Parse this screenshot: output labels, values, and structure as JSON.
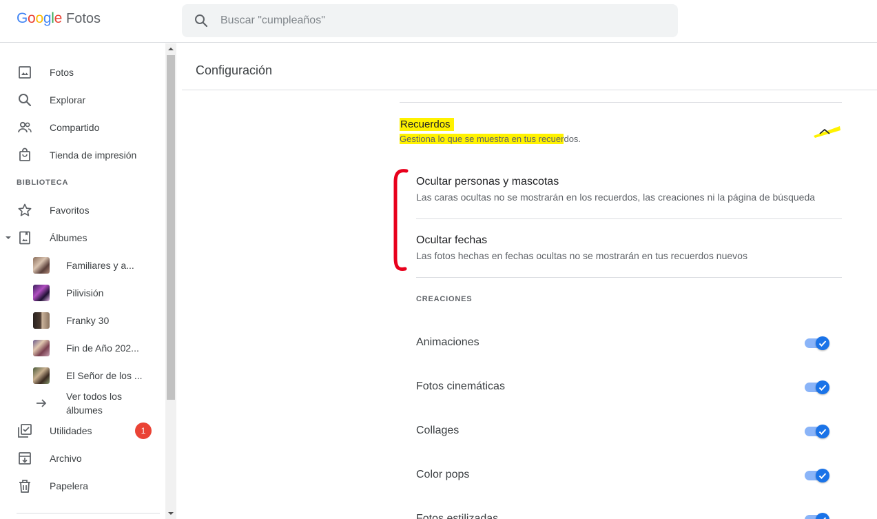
{
  "app": {
    "logo_google": "Google",
    "logo_product": "Fotos",
    "colors": {
      "blue": "#4285f4",
      "red": "#ea4335",
      "yellow": "#fbbc05",
      "green": "#34a853",
      "accent": "#1a73e8",
      "highlight": "#fff200",
      "annotation": "#e8001c"
    }
  },
  "search": {
    "placeholder": "Buscar \"cumpleaños\"",
    "value": "",
    "icon": "search-icon"
  },
  "sidebar": {
    "items": [
      {
        "label": "Fotos",
        "icon": "photo-icon"
      },
      {
        "label": "Explorar",
        "icon": "search-icon"
      },
      {
        "label": "Compartido",
        "icon": "people-icon"
      },
      {
        "label": "Tienda de impresión",
        "icon": "shopping-bag-icon"
      }
    ],
    "library_label": "BIBLIOTECA",
    "library": [
      {
        "label": "Favoritos",
        "icon": "star-icon"
      },
      {
        "label": "Álbumes",
        "icon": "album-icon",
        "expanded": true
      }
    ],
    "albums": [
      {
        "label": "Familiares y a..."
      },
      {
        "label": "Pilivisión"
      },
      {
        "label": "Franky 30"
      },
      {
        "label": "Fin de Año 202..."
      },
      {
        "label": "El Señor de los ..."
      }
    ],
    "see_all_line1": "Ver todos los",
    "see_all_line2": "álbumes",
    "utilities": {
      "label": "Utilidades",
      "badge": "1",
      "icon": "utilities-icon"
    },
    "archive": {
      "label": "Archivo",
      "icon": "archive-icon"
    },
    "trash": {
      "label": "Papelera",
      "icon": "trash-icon"
    }
  },
  "main": {
    "title": "Configuración",
    "memories": {
      "title": "Recuerdos",
      "subtitle_part1": "Gestiona lo que se muestra en tus recuer",
      "subtitle_part2": "dos.",
      "expanded": true
    },
    "options": [
      {
        "title": "Ocultar personas y mascotas",
        "subtitle": "Las caras ocultas no se mostrarán en los recuerdos, las creaciones ni la página de búsqueda"
      },
      {
        "title": "Ocultar fechas",
        "subtitle": "Las fotos hechas en fechas ocultas no se mostrarán en tus recuerdos nuevos"
      }
    ],
    "creations_label": "CREACIONES",
    "toggles": [
      {
        "label": "Animaciones",
        "on": true
      },
      {
        "label": "Fotos cinemáticas",
        "on": true
      },
      {
        "label": "Collages",
        "on": true
      },
      {
        "label": "Color pops",
        "on": true
      },
      {
        "label": "Fotos estilizadas",
        "on": true
      }
    ]
  }
}
